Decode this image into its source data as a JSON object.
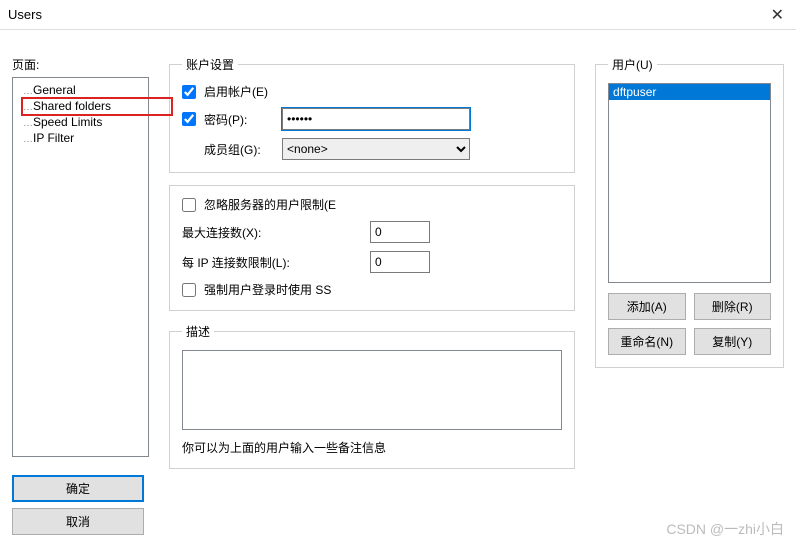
{
  "window": {
    "title": "Users"
  },
  "left": {
    "pages_label": "页面:",
    "items": [
      "General",
      "Shared folders",
      "Speed Limits",
      "IP Filter"
    ],
    "ok_label": "确定",
    "cancel_label": "取消"
  },
  "account": {
    "legend": "账户设置",
    "enable_label": "启用帐户(E)",
    "enable_checked": true,
    "password_label": "密码(P):",
    "password_checked": true,
    "password_value": "••••••",
    "group_label": "成员组(G):",
    "group_value": "<none>"
  },
  "limits": {
    "bypass_label": "忽略服务器的用户限制(E",
    "bypass_checked": false,
    "max_conn_label": "最大连接数(X):",
    "max_conn_value": "0",
    "per_ip_label": "每 IP 连接数限制(L):",
    "per_ip_value": "0",
    "force_ssl_label": "强制用户登录时使用 SS",
    "force_ssl_checked": false
  },
  "desc": {
    "legend": "描述",
    "value": "",
    "hint": "你可以为上面的用户输入一些备注信息"
  },
  "users": {
    "legend": "用户(U)",
    "items": [
      "dftpuser"
    ],
    "add_label": "添加(A)",
    "remove_label": "删除(R)",
    "rename_label": "重命名(N)",
    "copy_label": "复制(Y)"
  },
  "watermark": "CSDN @一zhi小白"
}
